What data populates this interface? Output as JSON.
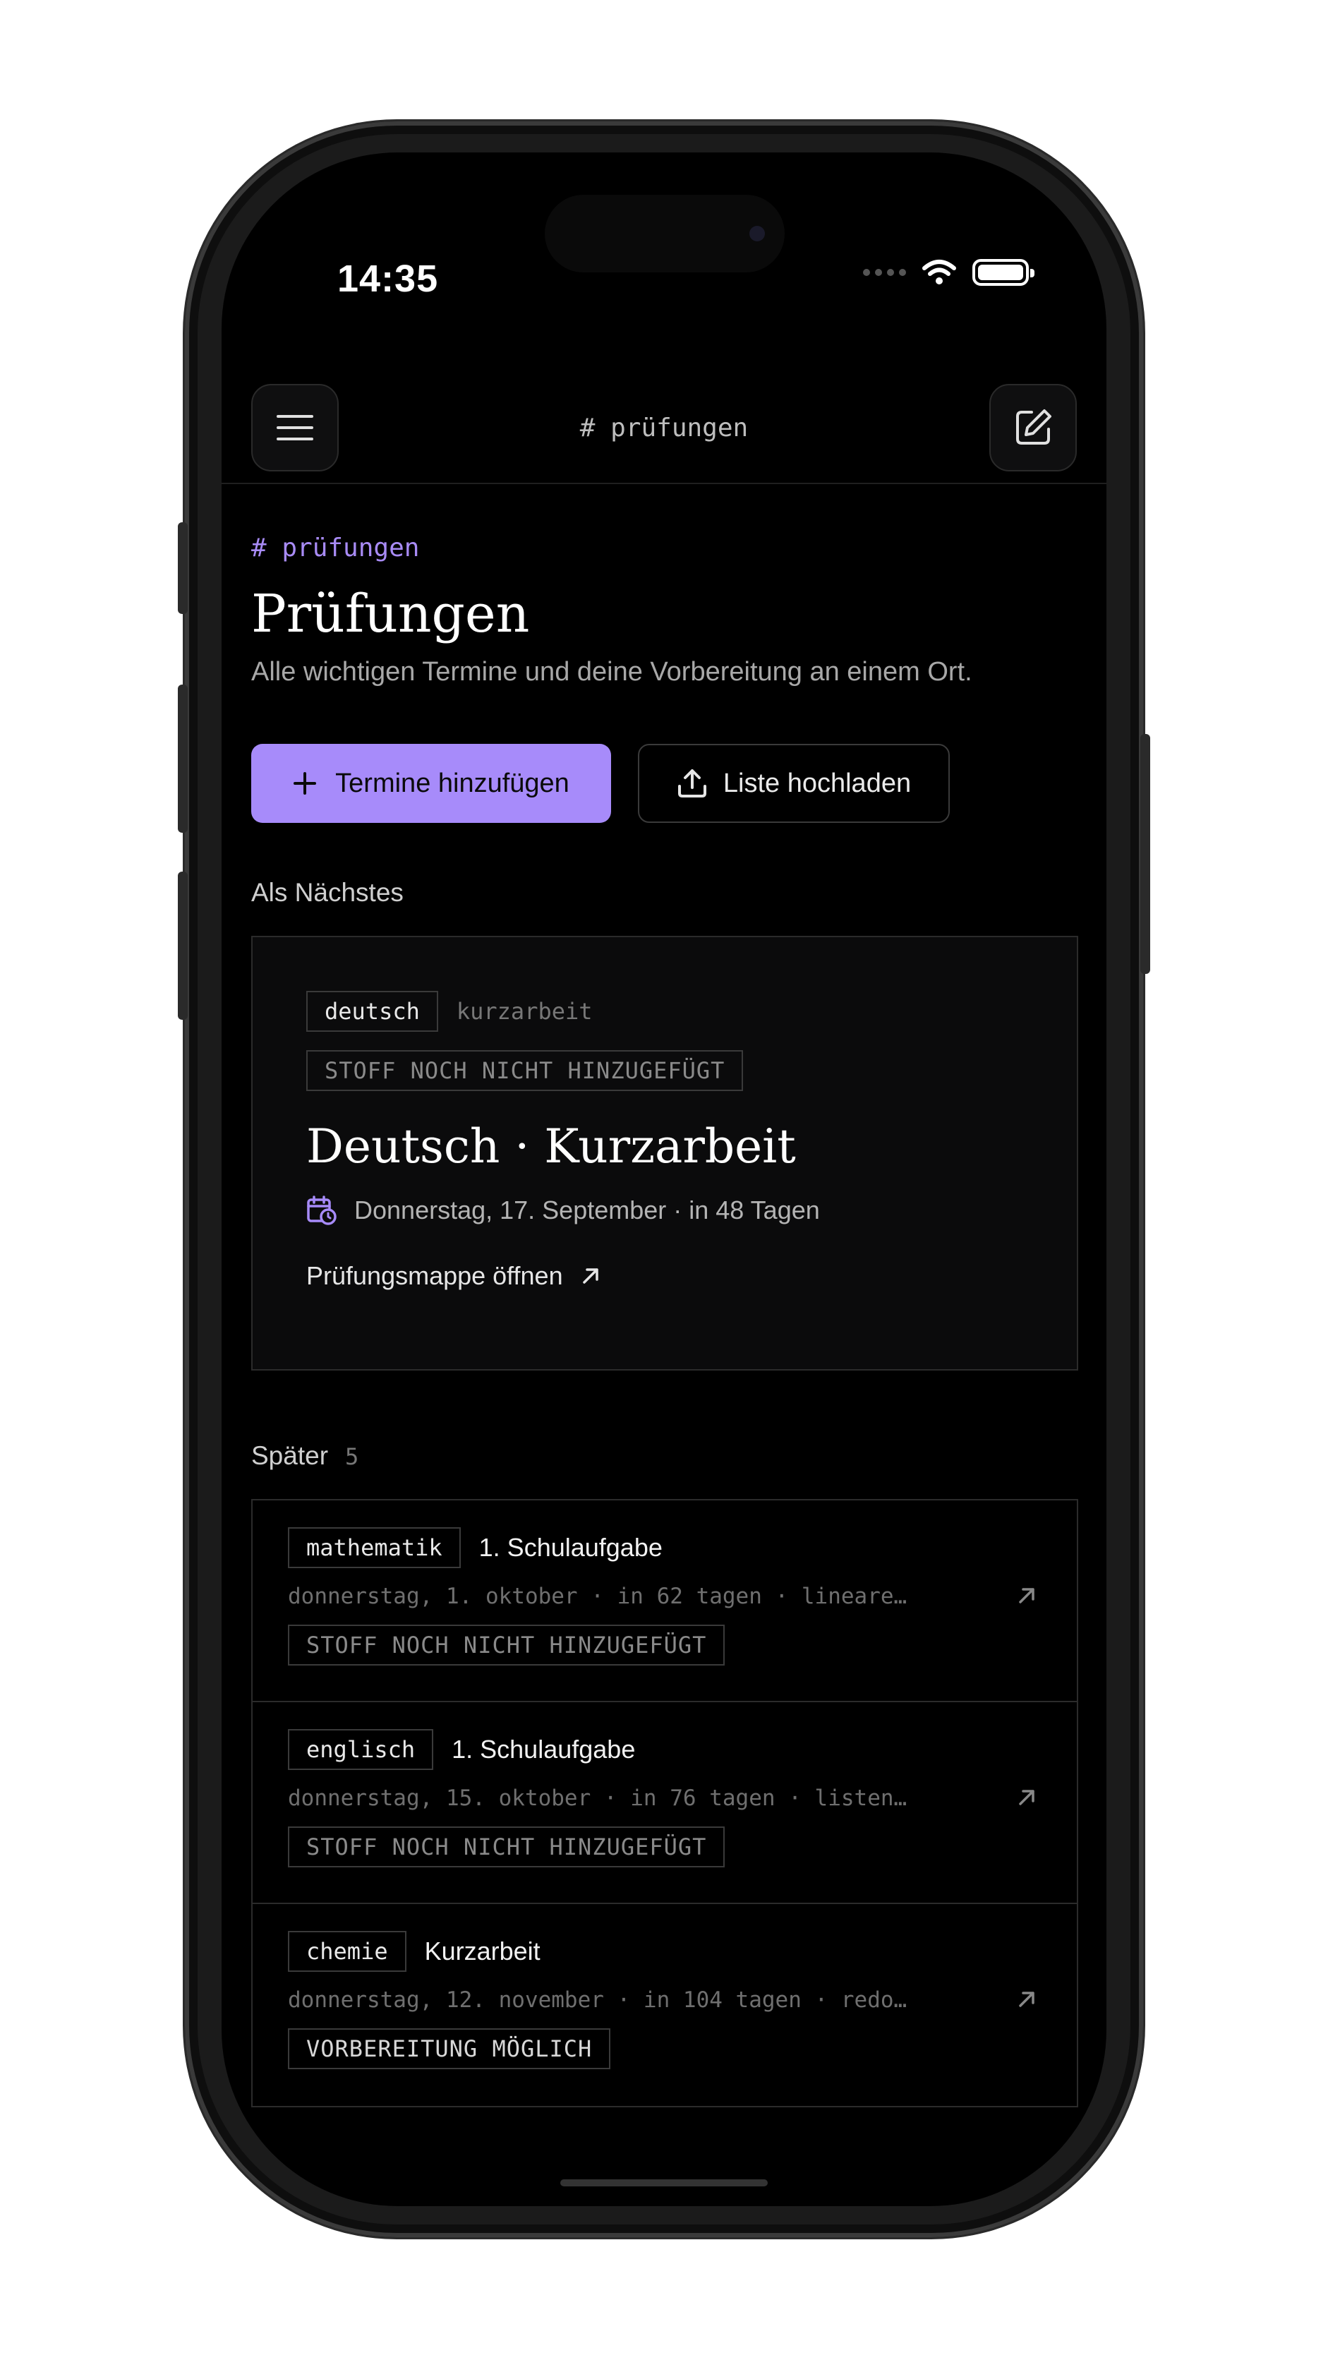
{
  "status_bar": {
    "time": "14:35"
  },
  "topbar": {
    "title": "# prüfungen"
  },
  "header": {
    "crumb": "# prüfungen",
    "title": "Prüfungen",
    "subtitle": "Alle wichtigen Termine und deine Vorbereitung an einem Ort."
  },
  "actions": {
    "add_label": "Termine hinzufügen",
    "upload_label": "Liste hochladen"
  },
  "next": {
    "section_label": "Als Nächstes",
    "subject_tag": "deutsch",
    "type_tag": "kurzarbeit",
    "status": "STOFF NOCH NICHT HINZUGEFÜGT",
    "title": "Deutsch · Kurzarbeit",
    "date": "Donnerstag, 17. September · in 48 Tagen",
    "link": "Prüfungsmappe öffnen"
  },
  "later": {
    "label": "Später",
    "count": "5",
    "items": [
      {
        "subject": "mathematik",
        "title": "1. Schulaufgabe",
        "meta": "donnerstag, 1. oktober · in 62 tagen · lineare…",
        "status": "STOFF NOCH NICHT HINZUGEFÜGT"
      },
      {
        "subject": "englisch",
        "title": "1. Schulaufgabe",
        "meta": "donnerstag, 15. oktober · in 76 tagen · listen…",
        "status": "STOFF NOCH NICHT HINZUGEFÜGT"
      },
      {
        "subject": "chemie",
        "title": "Kurzarbeit",
        "meta": "donnerstag, 12. november · in 104 tagen · redo…",
        "status": "VORBEREITUNG MÖGLICH"
      }
    ]
  },
  "colors": {
    "accent": "#a78bfa",
    "background": "#000000"
  }
}
